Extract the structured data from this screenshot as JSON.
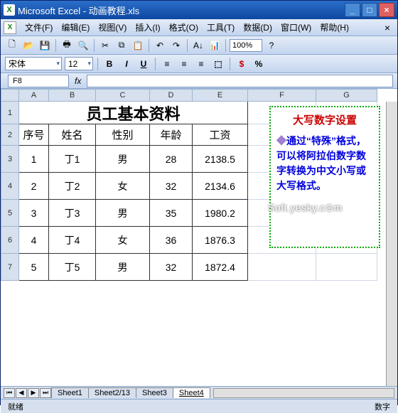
{
  "title": "Microsoft Excel - 动画教程.xls",
  "menus": [
    "文件(F)",
    "编辑(E)",
    "视图(V)",
    "插入(I)",
    "格式(O)",
    "工具(T)",
    "数据(D)",
    "窗口(W)",
    "帮助(H)"
  ],
  "zoom": "100%",
  "font": {
    "name": "宋体",
    "size": "12"
  },
  "namebox": "F8",
  "fxlabel": "fx",
  "colheaders": [
    "A",
    "B",
    "C",
    "D",
    "E",
    "F",
    "G"
  ],
  "rowheaders": [
    "1",
    "2",
    "3",
    "4",
    "5",
    "6",
    "7"
  ],
  "doc_title": "员工基本资料",
  "headers": {
    "a": "序号",
    "b": "姓名",
    "c": "性别",
    "d": "年龄",
    "e": "工资"
  },
  "rows": [
    {
      "no": "1",
      "name": "丁1",
      "sex": "男",
      "age": "28",
      "sal": "2138.5"
    },
    {
      "no": "2",
      "name": "丁2",
      "sex": "女",
      "age": "32",
      "sal": "2134.6"
    },
    {
      "no": "3",
      "name": "丁3",
      "sex": "男",
      "age": "35",
      "sal": "1980.2"
    },
    {
      "no": "4",
      "name": "丁4",
      "sex": "女",
      "age": "36",
      "sal": "1876.3"
    },
    {
      "no": "5",
      "name": "丁5",
      "sex": "男",
      "age": "32",
      "sal": "1872.4"
    }
  ],
  "note": {
    "title": "大写数字设置",
    "body": "通过“特殊”格式，可以将阿拉伯数字数字转换为中文小写或大写格式。"
  },
  "watermark": "Soft.yesky.c⊙m",
  "tabs": [
    "Sheet1",
    "Sheet2/13",
    "Sheet3",
    "Sheet4"
  ],
  "statusbar": {
    "ready": "就绪",
    "mode": "数字"
  },
  "icons": {
    "new": "🗋",
    "open": "📂",
    "save": "💾",
    "print": "🖶",
    "preview": "🔍",
    "cut": "✂",
    "copy": "⧉",
    "paste": "📋",
    "undo": "↶",
    "redo": "↷",
    "sort": "A↓",
    "chart": "📊",
    "help": "?",
    "bold": "B",
    "italic": "I",
    "underline": "U",
    "left": "≡",
    "center": "≡",
    "right": "≡",
    "merge": "⬚",
    "currency": "$",
    "percent": "%"
  }
}
